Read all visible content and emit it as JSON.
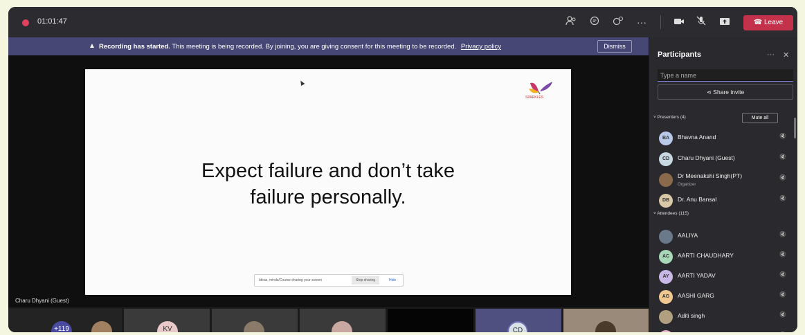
{
  "topbar": {
    "timer": "01:01:47",
    "leave_label": "Leave",
    "icons": [
      "participants-icon",
      "chat-icon",
      "reactions-icon",
      "more-icon",
      "camera-icon",
      "mic-off-icon",
      "share-icon"
    ]
  },
  "banner": {
    "bold": "Recording has started.",
    "text": "This meeting is being recorded. By joining, you are giving consent for this meeting to be recorded.",
    "link": "Privacy policy",
    "dismiss_label": "Dismiss"
  },
  "slide": {
    "line1": "Expect failure and don’t take",
    "line2": "failure personally.",
    "logo_text": "SPARKLES"
  },
  "share_bar": {
    "message": "Ideas, minds/Course sharing your screen",
    "stop_label": "Stop sharing",
    "hide_label": "Hide"
  },
  "speaker_name": "Charu Dhyani (Guest)",
  "gallery": [
    {
      "initials": "+119"
    },
    {
      "initials": ""
    },
    {
      "initials": "KV"
    },
    {
      "initials": ""
    },
    {
      "initials": ""
    },
    {
      "initials": ""
    },
    {
      "initials": "CD"
    },
    {
      "initials": ""
    }
  ],
  "participants": {
    "title": "Participants",
    "search_placeholder": "Type a name",
    "share_invite": "Share invite",
    "presenters_label": "Presenters (4)",
    "mute_all": "Mute all",
    "attendees_label": "Attendees (115)",
    "presenters": [
      {
        "initials": "BA",
        "name": "Bhavna Anand",
        "role": "",
        "color": "#b8c8e8"
      },
      {
        "initials": "CD",
        "name": "Charu Dhyani (Guest)",
        "role": "",
        "color": "#c8d8e0"
      },
      {
        "initials": "",
        "name": "Dr Meenakshi Singh(PT)",
        "role": "Organizer",
        "color": "#8a6a4a"
      },
      {
        "initials": "DB",
        "name": "Dr. Anu Bansal",
        "role": "",
        "color": "#d8c8a8"
      }
    ],
    "attendees": [
      {
        "initials": "",
        "name": "AALIYA",
        "color": "#6a7a8a"
      },
      {
        "initials": "AC",
        "name": "AARTI CHAUDHARY",
        "color": "#a8d8b8"
      },
      {
        "initials": "AY",
        "name": "AARTI YADAV",
        "color": "#c8b8e8"
      },
      {
        "initials": "AG",
        "name": "AASHI GARG",
        "color": "#f0c890"
      },
      {
        "initials": "",
        "name": "Aditi singh",
        "color": "#b0a080"
      },
      {
        "initials": "",
        "name": "AJAY AGLEEL",
        "color": "#e8b8c8"
      }
    ]
  }
}
